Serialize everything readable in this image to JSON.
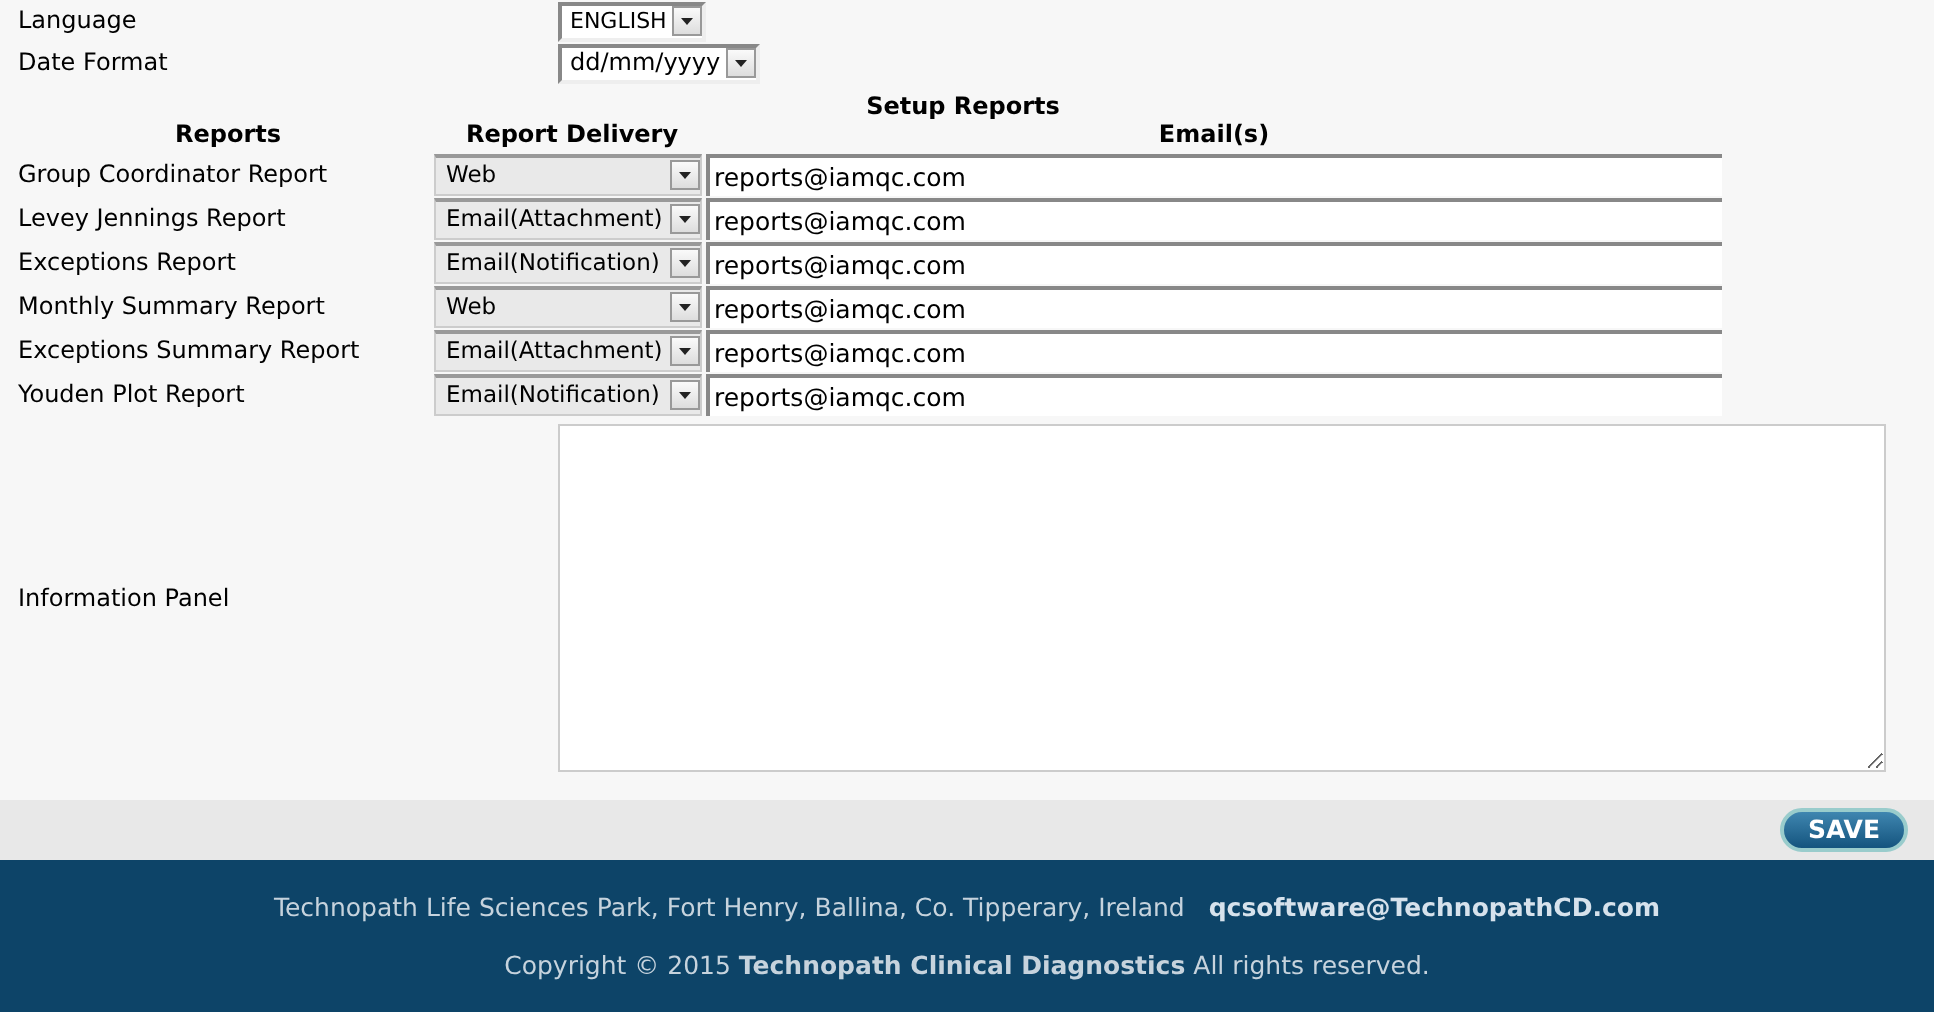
{
  "settings": [
    {
      "label": "Language",
      "value": "ENGLISH",
      "kind": "small"
    },
    {
      "label": "Date Format",
      "value": "dd/mm/yyyy",
      "kind": "normal"
    }
  ],
  "setup_reports": {
    "title": "Setup Reports",
    "columns": [
      "Reports",
      "Report Delivery",
      "Email(s)"
    ],
    "rows": [
      {
        "report": "Group Coordinator Report",
        "delivery": "Web",
        "email": "reports@iamqc.com"
      },
      {
        "report": "Levey Jennings Report",
        "delivery": "Email(Attachment)",
        "email": "reports@iamqc.com"
      },
      {
        "report": "Exceptions Report",
        "delivery": "Email(Notification)",
        "email": "reports@iamqc.com"
      },
      {
        "report": "Monthly Summary Report",
        "delivery": "Web",
        "email": "reports@iamqc.com"
      },
      {
        "report": "Exceptions Summary Report",
        "delivery": "Email(Attachment)",
        "email": "reports@iamqc.com"
      },
      {
        "report": "Youden Plot Report",
        "delivery": "Email(Notification)",
        "email": "reports@iamqc.com"
      }
    ]
  },
  "information_panel": {
    "label": "Information Panel"
  },
  "save_button": "SAVE",
  "footer": {
    "address": "Technopath Life Sciences Park, Fort Henry, Ballina, Co. Tipperary, Ireland",
    "email": "qcsoftware@TechnopathCD.com",
    "copyright": "Copyright © 2015 **Technopath Clinical Diagnostics** All rights reserved."
  }
}
